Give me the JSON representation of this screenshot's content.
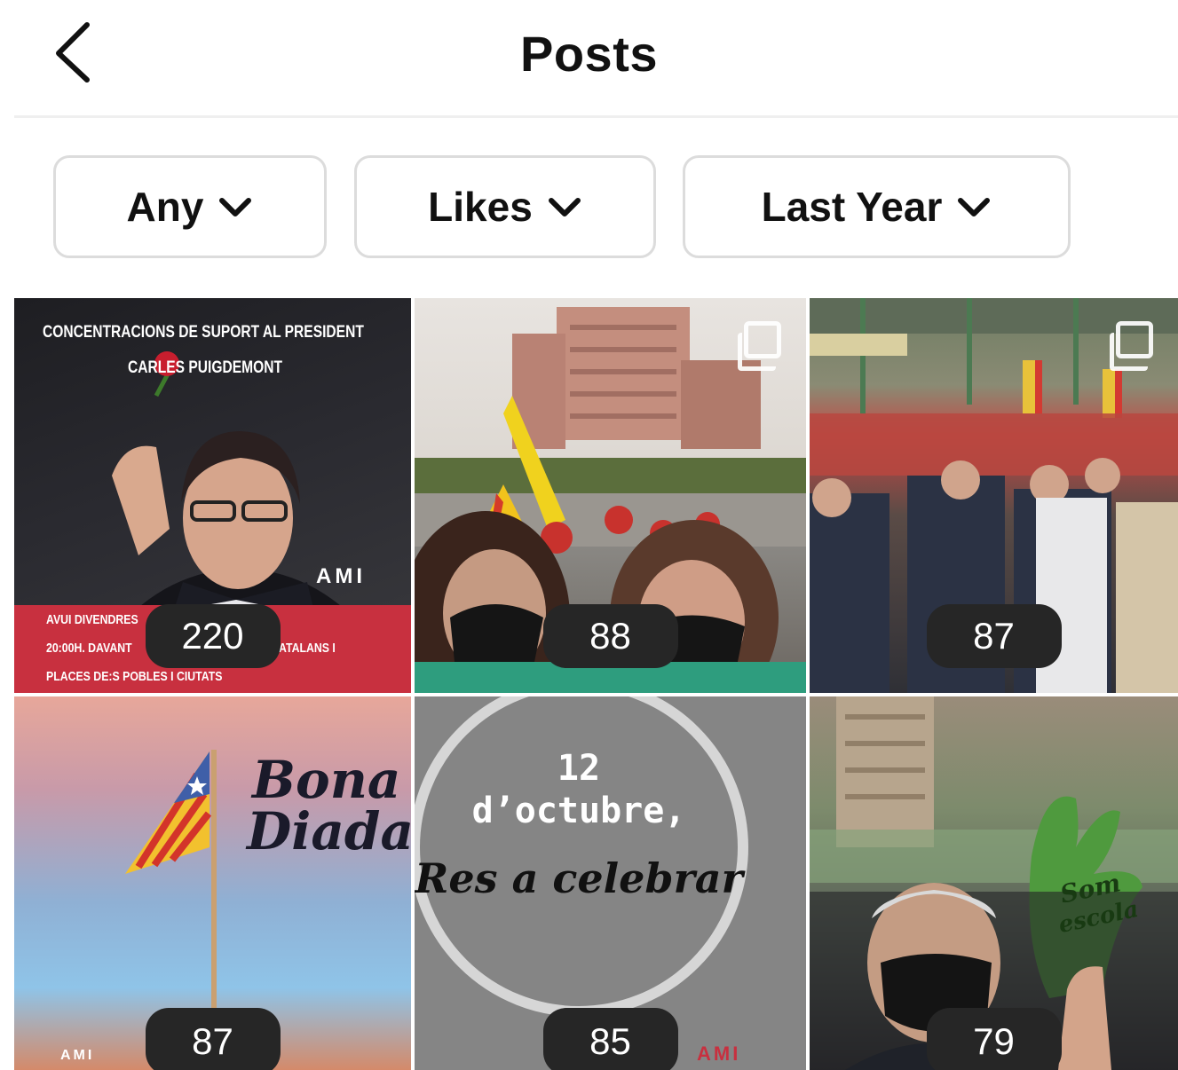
{
  "header": {
    "title": "Posts",
    "back_icon": "chevron-left-icon"
  },
  "filters": [
    {
      "label": "Any",
      "icon": "chevron-down-icon"
    },
    {
      "label": "Likes",
      "icon": "chevron-down-icon"
    },
    {
      "label": "Last Year",
      "icon": "chevron-down-icon"
    }
  ],
  "posts": [
    {
      "count": "220",
      "text": {
        "line1": "CONCENTRACIONS DE SUPORT AL PRESIDENT",
        "line2": "CARLES PUIGDEMONT",
        "footer1": "AVUI DIVENDRES",
        "footer2": "20:00H. DAVANT",
        "footer3": "ATALANS I",
        "footer4": "PLACES DE:S POBLES I CIUTATS",
        "logo": "AMI"
      }
    },
    {
      "count": "88"
    },
    {
      "count": "87"
    },
    {
      "count": "87",
      "text": {
        "script1": "Bona",
        "script2": "Diada",
        "logo": "AMI"
      }
    },
    {
      "count": "85",
      "text": {
        "line1": "12",
        "line2": "d’octubre,",
        "script": "Res a celebrar",
        "logo": "AMI"
      }
    },
    {
      "count": "79",
      "text": {
        "sign1": "Som",
        "sign2": "escola"
      }
    }
  ],
  "colors": {
    "badge": "#262626",
    "poster_red": "#c8303f",
    "poster_gray": "#858585"
  }
}
